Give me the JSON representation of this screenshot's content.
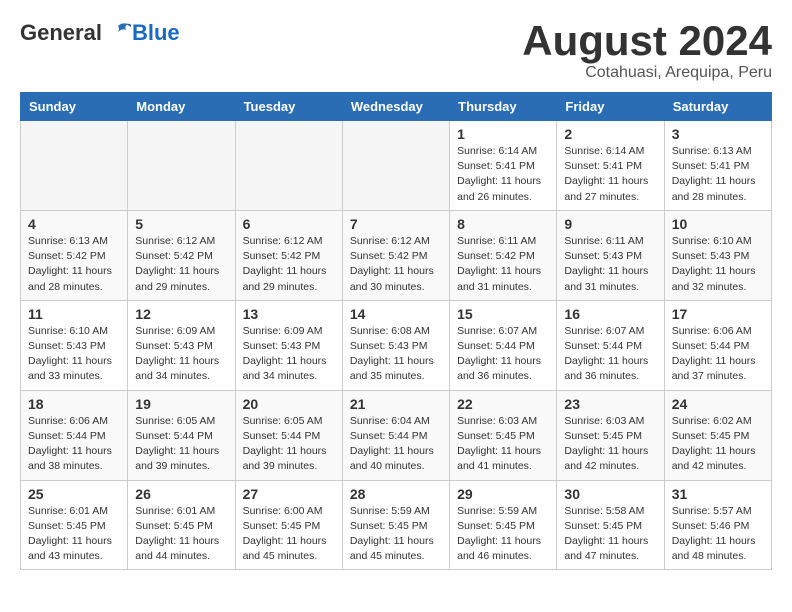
{
  "header": {
    "logo_general": "General",
    "logo_blue": "Blue",
    "month_title": "August 2024",
    "subtitle": "Cotahuasi, Arequipa, Peru"
  },
  "days_of_week": [
    "Sunday",
    "Monday",
    "Tuesday",
    "Wednesday",
    "Thursday",
    "Friday",
    "Saturday"
  ],
  "weeks": [
    [
      {
        "day": "",
        "info": ""
      },
      {
        "day": "",
        "info": ""
      },
      {
        "day": "",
        "info": ""
      },
      {
        "day": "",
        "info": ""
      },
      {
        "day": "1",
        "info": "Sunrise: 6:14 AM\nSunset: 5:41 PM\nDaylight: 11 hours\nand 26 minutes."
      },
      {
        "day": "2",
        "info": "Sunrise: 6:14 AM\nSunset: 5:41 PM\nDaylight: 11 hours\nand 27 minutes."
      },
      {
        "day": "3",
        "info": "Sunrise: 6:13 AM\nSunset: 5:41 PM\nDaylight: 11 hours\nand 28 minutes."
      }
    ],
    [
      {
        "day": "4",
        "info": "Sunrise: 6:13 AM\nSunset: 5:42 PM\nDaylight: 11 hours\nand 28 minutes."
      },
      {
        "day": "5",
        "info": "Sunrise: 6:12 AM\nSunset: 5:42 PM\nDaylight: 11 hours\nand 29 minutes."
      },
      {
        "day": "6",
        "info": "Sunrise: 6:12 AM\nSunset: 5:42 PM\nDaylight: 11 hours\nand 29 minutes."
      },
      {
        "day": "7",
        "info": "Sunrise: 6:12 AM\nSunset: 5:42 PM\nDaylight: 11 hours\nand 30 minutes."
      },
      {
        "day": "8",
        "info": "Sunrise: 6:11 AM\nSunset: 5:42 PM\nDaylight: 11 hours\nand 31 minutes."
      },
      {
        "day": "9",
        "info": "Sunrise: 6:11 AM\nSunset: 5:43 PM\nDaylight: 11 hours\nand 31 minutes."
      },
      {
        "day": "10",
        "info": "Sunrise: 6:10 AM\nSunset: 5:43 PM\nDaylight: 11 hours\nand 32 minutes."
      }
    ],
    [
      {
        "day": "11",
        "info": "Sunrise: 6:10 AM\nSunset: 5:43 PM\nDaylight: 11 hours\nand 33 minutes."
      },
      {
        "day": "12",
        "info": "Sunrise: 6:09 AM\nSunset: 5:43 PM\nDaylight: 11 hours\nand 34 minutes."
      },
      {
        "day": "13",
        "info": "Sunrise: 6:09 AM\nSunset: 5:43 PM\nDaylight: 11 hours\nand 34 minutes."
      },
      {
        "day": "14",
        "info": "Sunrise: 6:08 AM\nSunset: 5:43 PM\nDaylight: 11 hours\nand 35 minutes."
      },
      {
        "day": "15",
        "info": "Sunrise: 6:07 AM\nSunset: 5:44 PM\nDaylight: 11 hours\nand 36 minutes."
      },
      {
        "day": "16",
        "info": "Sunrise: 6:07 AM\nSunset: 5:44 PM\nDaylight: 11 hours\nand 36 minutes."
      },
      {
        "day": "17",
        "info": "Sunrise: 6:06 AM\nSunset: 5:44 PM\nDaylight: 11 hours\nand 37 minutes."
      }
    ],
    [
      {
        "day": "18",
        "info": "Sunrise: 6:06 AM\nSunset: 5:44 PM\nDaylight: 11 hours\nand 38 minutes."
      },
      {
        "day": "19",
        "info": "Sunrise: 6:05 AM\nSunset: 5:44 PM\nDaylight: 11 hours\nand 39 minutes."
      },
      {
        "day": "20",
        "info": "Sunrise: 6:05 AM\nSunset: 5:44 PM\nDaylight: 11 hours\nand 39 minutes."
      },
      {
        "day": "21",
        "info": "Sunrise: 6:04 AM\nSunset: 5:44 PM\nDaylight: 11 hours\nand 40 minutes."
      },
      {
        "day": "22",
        "info": "Sunrise: 6:03 AM\nSunset: 5:45 PM\nDaylight: 11 hours\nand 41 minutes."
      },
      {
        "day": "23",
        "info": "Sunrise: 6:03 AM\nSunset: 5:45 PM\nDaylight: 11 hours\nand 42 minutes."
      },
      {
        "day": "24",
        "info": "Sunrise: 6:02 AM\nSunset: 5:45 PM\nDaylight: 11 hours\nand 42 minutes."
      }
    ],
    [
      {
        "day": "25",
        "info": "Sunrise: 6:01 AM\nSunset: 5:45 PM\nDaylight: 11 hours\nand 43 minutes."
      },
      {
        "day": "26",
        "info": "Sunrise: 6:01 AM\nSunset: 5:45 PM\nDaylight: 11 hours\nand 44 minutes."
      },
      {
        "day": "27",
        "info": "Sunrise: 6:00 AM\nSunset: 5:45 PM\nDaylight: 11 hours\nand 45 minutes."
      },
      {
        "day": "28",
        "info": "Sunrise: 5:59 AM\nSunset: 5:45 PM\nDaylight: 11 hours\nand 45 minutes."
      },
      {
        "day": "29",
        "info": "Sunrise: 5:59 AM\nSunset: 5:45 PM\nDaylight: 11 hours\nand 46 minutes."
      },
      {
        "day": "30",
        "info": "Sunrise: 5:58 AM\nSunset: 5:45 PM\nDaylight: 11 hours\nand 47 minutes."
      },
      {
        "day": "31",
        "info": "Sunrise: 5:57 AM\nSunset: 5:46 PM\nDaylight: 11 hours\nand 48 minutes."
      }
    ]
  ]
}
